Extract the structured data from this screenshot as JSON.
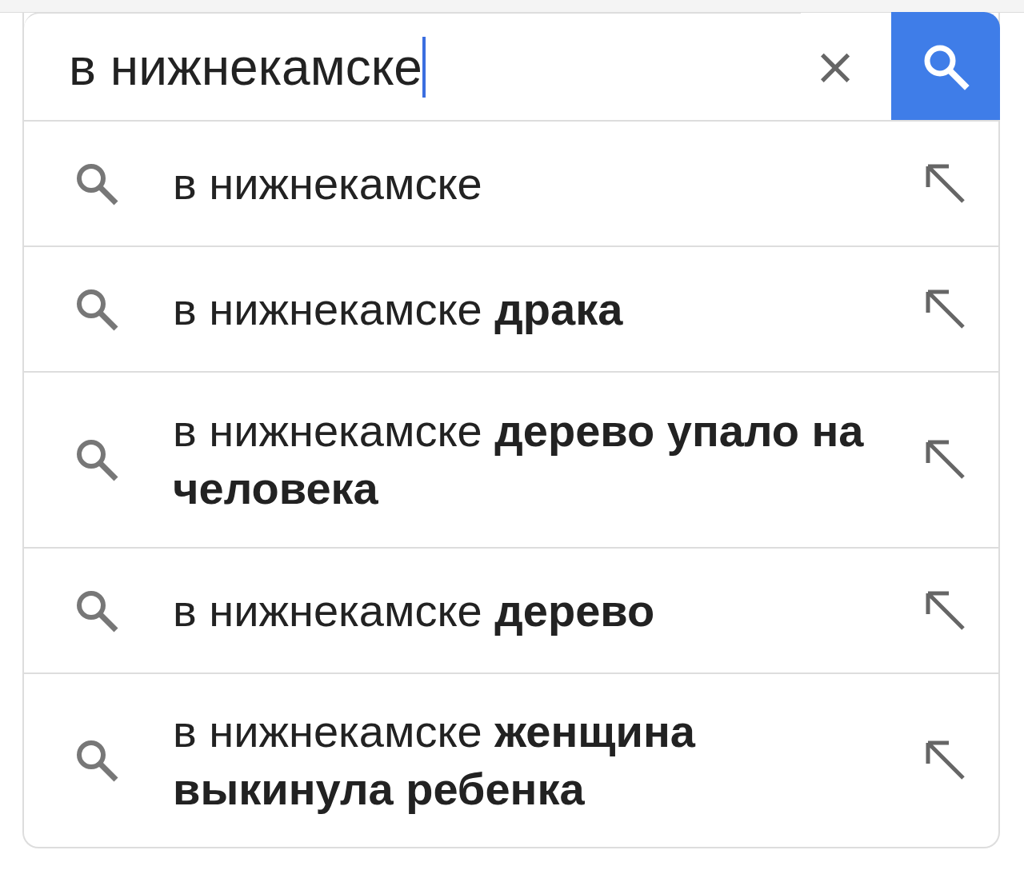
{
  "search": {
    "value": "в нижнекамске",
    "focused": true,
    "clear_label": "×"
  },
  "suggestions": [
    {
      "text": "в нижнекамске"
    },
    {
      "text": "в нижнекамске **драка**"
    },
    {
      "text": "в нижнекамске **дерево упало на человека**"
    },
    {
      "text": "в нижнекамске **дерево**"
    },
    {
      "text": "в нижнекамске **женщина выкинула ребенка**"
    }
  ]
}
